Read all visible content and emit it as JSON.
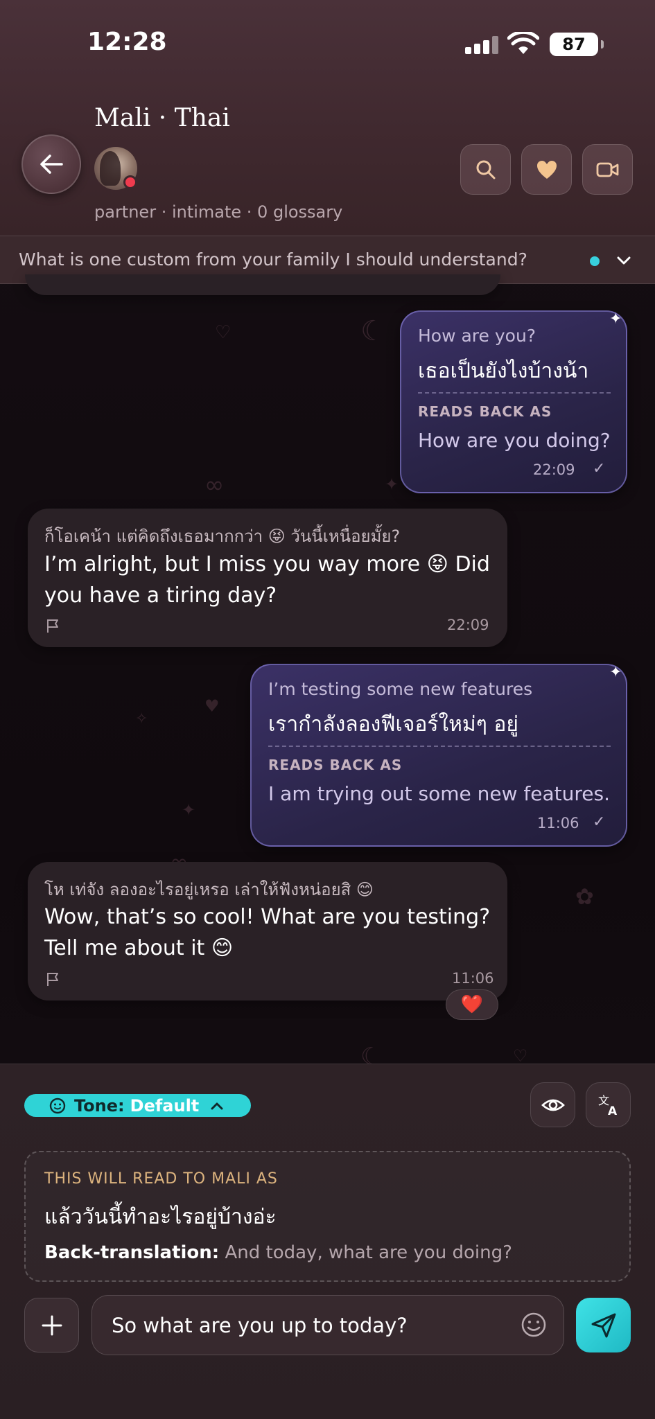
{
  "status_bar": {
    "time": "12:28",
    "battery": "87"
  },
  "header": {
    "contact_name": "Mali · Thai",
    "meta": "partner · intimate · 0 glossary",
    "icons": [
      "back-arrow-icon",
      "search-icon",
      "heart-icon",
      "video-icon"
    ]
  },
  "prompt": {
    "text": "What is one custom from your family I should understand?",
    "accent": "#38d0dd"
  },
  "messages": [
    {
      "direction": "outgoing",
      "english": "How are you?",
      "thai": "เธอเป็นยังไงบ้างน้า",
      "reads_back_label": "READS BACK AS",
      "reads_back": "How are you doing?",
      "time": "22:09",
      "check": "✓"
    },
    {
      "direction": "incoming",
      "thai": "ก็โอเคน้า แต่คิดถึงเธอมากกว่า 😝 วันนี้เหนื่อยมั้ย?",
      "english_line1": "I’m alright, but I miss you way more 😝 Did",
      "english_line2": "you have a tiring day?",
      "time": "22:09"
    },
    {
      "direction": "outgoing",
      "english": "I’m testing some new features",
      "thai": "เรากำลังลองฟีเจอร์ใหม่ๆ อยู่",
      "reads_back_label": "READS BACK AS",
      "reads_back": "I am trying out some new features.",
      "time": "11:06",
      "check": "✓"
    },
    {
      "direction": "incoming",
      "thai": "โห เท่จัง ลองอะไรอยู่เหรอ เล่าให้ฟังหน่อยสิ 😊",
      "english_line1": "Wow, that’s so cool! What are you testing?",
      "english_line2": "Tell me about it 😊",
      "time": "11:06",
      "reaction": "❤️"
    }
  ],
  "composer": {
    "tone_label": "Tone:",
    "tone_value": "Default",
    "preview_label": "THIS WILL READ TO MALI AS",
    "preview_thai": "แล้ววันนี้ทำอะไรอยู่บ้างอ่ะ",
    "back_translation_label": "Back-translation:",
    "back_translation": "And today, what are you doing?",
    "input_value": "So what are you up to today?",
    "accent": "#2fd3d6"
  }
}
